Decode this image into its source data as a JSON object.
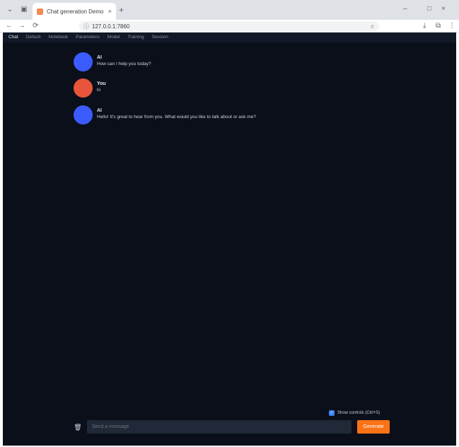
{
  "browser": {
    "tab_title": "Chat generation Demo",
    "url": "127.0.0.1:7860",
    "icons": {
      "tab_close": "×",
      "new_tab": "+",
      "back": "←",
      "forward": "→",
      "reload": "⟳",
      "info": "ⓘ",
      "lock": "⚿",
      "download": "⤓",
      "extensions": "⧉",
      "menu": "⋮",
      "minimize": "–",
      "maximize": "□",
      "close": "×",
      "tab_search": "⌄",
      "bookmark": "☆"
    }
  },
  "nav": {
    "tabs": [
      "Chat",
      "Default",
      "Notebook",
      "Parameters",
      "Model",
      "Training",
      "Session"
    ],
    "active": "Chat"
  },
  "chat": {
    "messages": [
      {
        "role": "bot",
        "name": "AI",
        "text": "How can I help you today?",
        "avatar_color": "#3b5bff"
      },
      {
        "role": "user",
        "name": "You",
        "text": "hi",
        "avatar_color": "#e8553a"
      },
      {
        "role": "bot",
        "name": "AI",
        "text": "Hello! It's great to hear from you. What would you like to talk about or ask me?",
        "avatar_color": "#3b5bff"
      }
    ]
  },
  "controls": {
    "toggle_label": "Show controls (Ctrl+S)",
    "toggle_checked": true,
    "input_placeholder": "Send a message",
    "submit_label": "Generate",
    "trash_icon": "🗑"
  },
  "colors": {
    "app_bg": "#0b0f19",
    "accent": "#f97316"
  }
}
